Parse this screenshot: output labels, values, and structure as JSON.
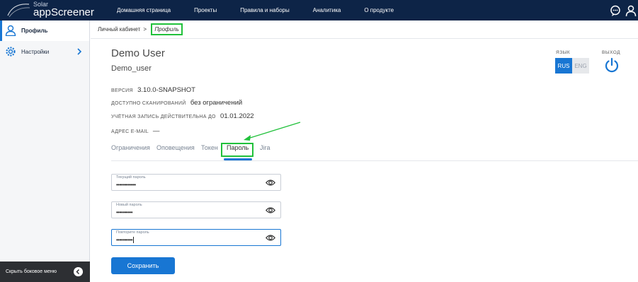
{
  "header": {
    "logo_small": "Solar",
    "logo_big": "appScreener",
    "nav": [
      "Домашняя страница",
      "Проекты",
      "Правила и наборы",
      "Аналитика",
      "О продукте"
    ],
    "icons": [
      "chat-icon",
      "user-icon"
    ]
  },
  "sidebar": {
    "items": [
      {
        "label": "Профиль",
        "icon": "user-icon",
        "active": true
      },
      {
        "label": "Настройки",
        "icon": "gear-icon",
        "active": false
      }
    ],
    "hide_label": "Скрыть боковое меню"
  },
  "breadcrumb": {
    "parent": "Личный кабинет",
    "separator": ">",
    "current": "Профиль"
  },
  "profile": {
    "name": "Demo User",
    "login": "Demo_user",
    "version_label": "ВЕРСИЯ",
    "version_value": "3.10.0-SNAPSHOT",
    "scans_label": "ДОСТУПНО СКАНИРОВАНИЙ",
    "scans_value": "без ограничений",
    "valid_label": "УЧЁТНАЯ ЗАПИСЬ ДЕЙСТВИТЕЛЬНА ДО",
    "valid_value": "01.01.2022",
    "email_label": "АДРЕС E-MAIL",
    "email_value": "—"
  },
  "language": {
    "label": "ЯЗЫК",
    "options": [
      "RUS",
      "ENG"
    ],
    "selected": "RUS"
  },
  "exit": {
    "label": "ВЫХОД"
  },
  "tabs": {
    "items": [
      "Ограничения",
      "Оповещения",
      "Токен",
      "Пароль",
      "Jira"
    ],
    "active": "Пароль"
  },
  "password_form": {
    "current_label": "Текущий пароль",
    "current_value": "••••••••••••",
    "new_label": "Новый пароль",
    "new_value": "••••••••••",
    "repeat_label": "Повторите пароль",
    "repeat_value": "••••••••••",
    "save_label": "Сохранить"
  },
  "colors": {
    "topbar": "#0d2447",
    "accent": "#1876d3",
    "highlight": "#21c13b"
  }
}
